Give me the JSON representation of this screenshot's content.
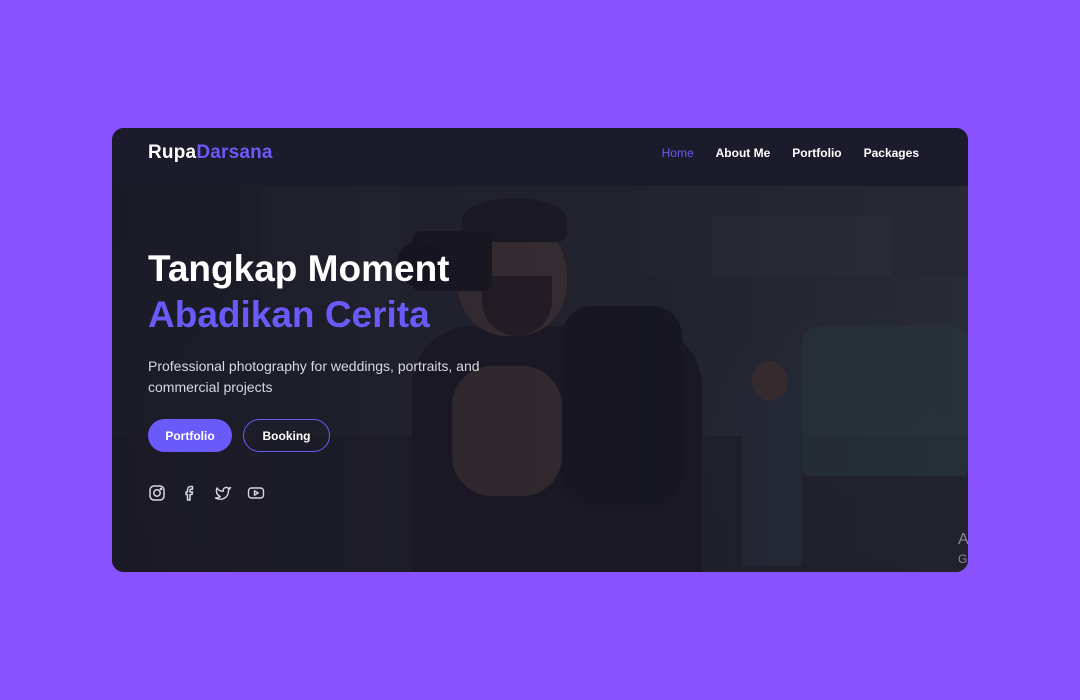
{
  "brand": {
    "part1": "Rupa",
    "part2": "Darsana"
  },
  "nav": {
    "items": [
      {
        "label": "Home",
        "active": true
      },
      {
        "label": "About Me",
        "active": false
      },
      {
        "label": "Portfolio",
        "active": false
      },
      {
        "label": "Packages",
        "active": false
      }
    ]
  },
  "hero": {
    "title_line1": "Tangkap Moment",
    "title_line2": "Abadikan Cerita",
    "subtitle": "Professional photography for weddings, portraits, and commercial projects",
    "primary_button": "Portfolio",
    "secondary_button": "Booking",
    "socials": [
      "instagram-icon",
      "facebook-icon",
      "twitter-icon",
      "youtube-icon"
    ]
  },
  "corner_text": {
    "line1": "A",
    "line2": "G"
  },
  "colors": {
    "background": "#8a52ff",
    "accent": "#6a5af9",
    "card": "#1c1b2b"
  }
}
